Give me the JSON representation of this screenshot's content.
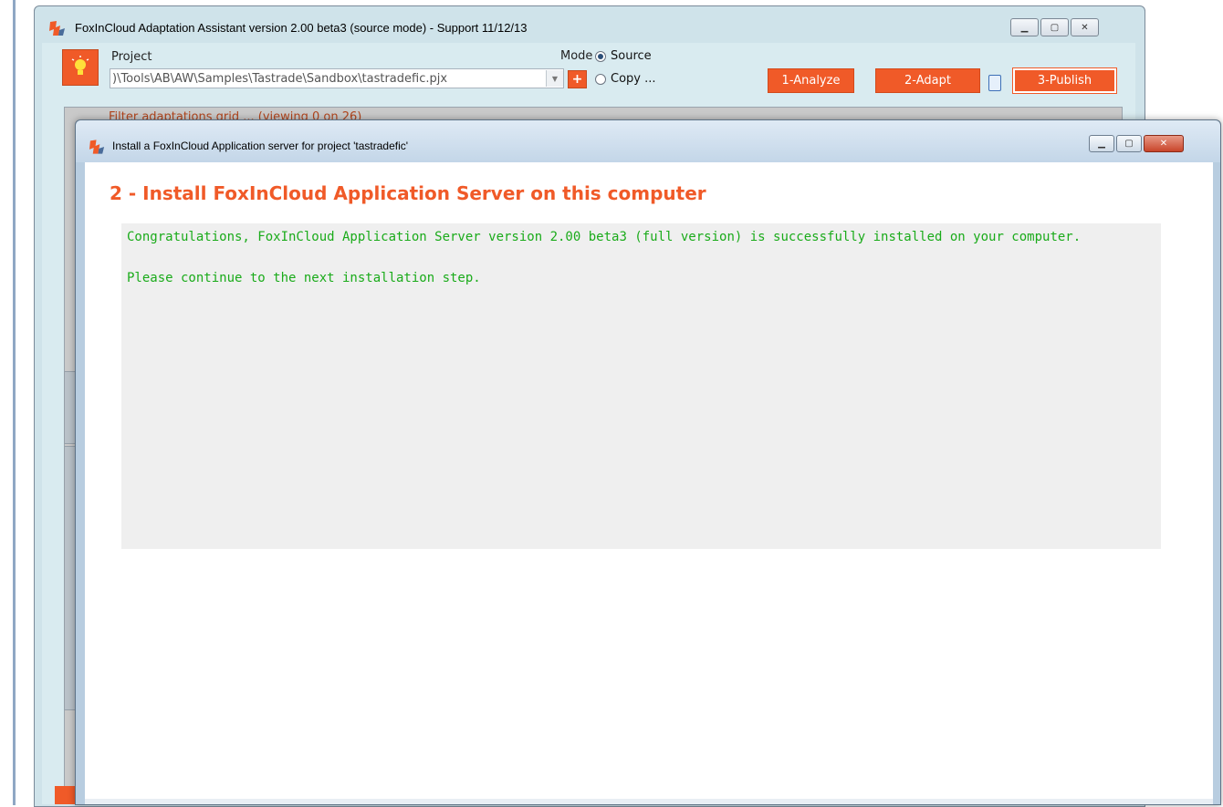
{
  "main_window": {
    "title": "FoxInCloud Adaptation Assistant version 2.00 beta3 (source mode) - Support 11/12/13",
    "project_label": "Project",
    "project_path": ")\\Tools\\AB\\AW\\Samples\\Tastrade\\Sandbox\\tastradefic.pjx",
    "plus_label": "+",
    "mode_label": "Mode",
    "mode_options": [
      {
        "label": "Source",
        "selected": true
      },
      {
        "label": "Copy ...",
        "selected": false
      }
    ],
    "buttons": {
      "analyze": "1-Analyze",
      "adapt": "2-Adapt",
      "publish": "3-Publish"
    },
    "filter_text": "Filter adaptations grid ... (viewing 0 on 26)"
  },
  "dialog": {
    "title": "Install a FoxInCloud Application server for project 'tastradefic'",
    "heading": "2 - Install FoxInCloud Application Server on this computer",
    "messages": [
      "Congratulations, FoxInCloud Application Server version 2.00 beta3 (full version) is successfully installed on your computer.",
      "Please continue to the next installation step."
    ]
  },
  "colors": {
    "accent": "#f05a28",
    "success_text": "#1aab1a",
    "filter_text": "#b0441c"
  },
  "icons": [
    "foxincloud-app-icon",
    "lightbulb-icon",
    "document-icon",
    "minimize-icon",
    "maximize-icon",
    "close-icon",
    "dropdown-arrow-icon"
  ]
}
